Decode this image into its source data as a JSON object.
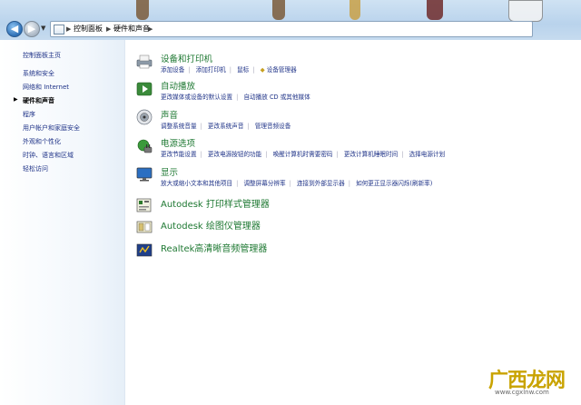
{
  "address": {
    "crumbs": [
      "控制面板",
      "硬件和声音"
    ]
  },
  "sidebar": {
    "home": "控制面板主页",
    "items": [
      {
        "label": "系统和安全"
      },
      {
        "label": "网络和 Internet"
      },
      {
        "label": "硬件和声音",
        "active": true
      },
      {
        "label": "程序"
      },
      {
        "label": "用户帐户和家庭安全"
      },
      {
        "label": "外观和个性化"
      },
      {
        "label": "时钟、语言和区域"
      },
      {
        "label": "轻松访问"
      }
    ]
  },
  "categories": [
    {
      "title": "设备和打印机",
      "icon": "printer-icon",
      "links": [
        "添加设备",
        "添加打印机",
        "鼠标",
        "设备管理器"
      ]
    },
    {
      "title": "自动播放",
      "icon": "autoplay-icon",
      "links": [
        "更改媒体或设备的默认设置",
        "自动播放 CD 或其他媒体"
      ]
    },
    {
      "title": "声音",
      "icon": "speaker-icon",
      "links": [
        "调整系统音量",
        "更改系统声音",
        "管理音频设备"
      ]
    },
    {
      "title": "电源选项",
      "icon": "power-options-icon",
      "links": [
        "更改节能设置",
        "更改电源按钮的功能",
        "唤醒计算机时需要密码",
        "更改计算机睡眠时间",
        "选择电源计划"
      ]
    },
    {
      "title": "显示",
      "icon": "display-icon",
      "links": [
        "放大或缩小文本和其他项目",
        "调整屏幕分辨率",
        "连接到外部显示器",
        "如何更正显示器闪烁(刷新率)"
      ]
    },
    {
      "title": "Autodesk 打印样式管理器",
      "icon": "autodesk-print-style-icon",
      "links": []
    },
    {
      "title": "Autodesk 绘图仪管理器",
      "icon": "autodesk-plotter-icon",
      "links": []
    },
    {
      "title": "Realtek高清晰音频管理器",
      "icon": "realtek-audio-icon",
      "links": []
    }
  ],
  "watermark": {
    "text": "广西龙网",
    "url": "www.cgxlnw.com"
  }
}
